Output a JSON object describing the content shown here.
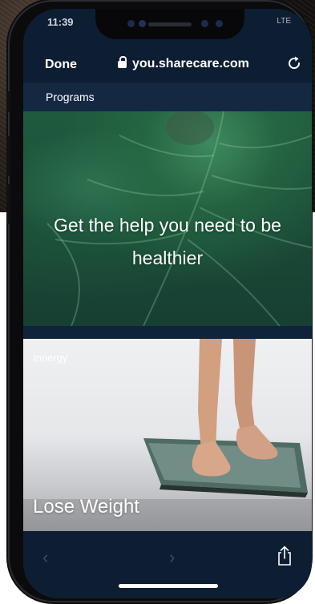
{
  "status": {
    "time": "11:39",
    "signal": "LTE"
  },
  "navbar": {
    "done_label": "Done",
    "url": "you.sharecare.com"
  },
  "section": {
    "title": "Programs"
  },
  "hero": {
    "headline": "Get the help you need to be healthier"
  },
  "card": {
    "brand": "Innergy",
    "title": "Lose Weight"
  },
  "toolbar": {
    "back": "‹",
    "forward": "›"
  },
  "colors": {
    "nav_bg": "#0d1e33",
    "header_bg": "#142842",
    "accent": "#ffffff"
  }
}
